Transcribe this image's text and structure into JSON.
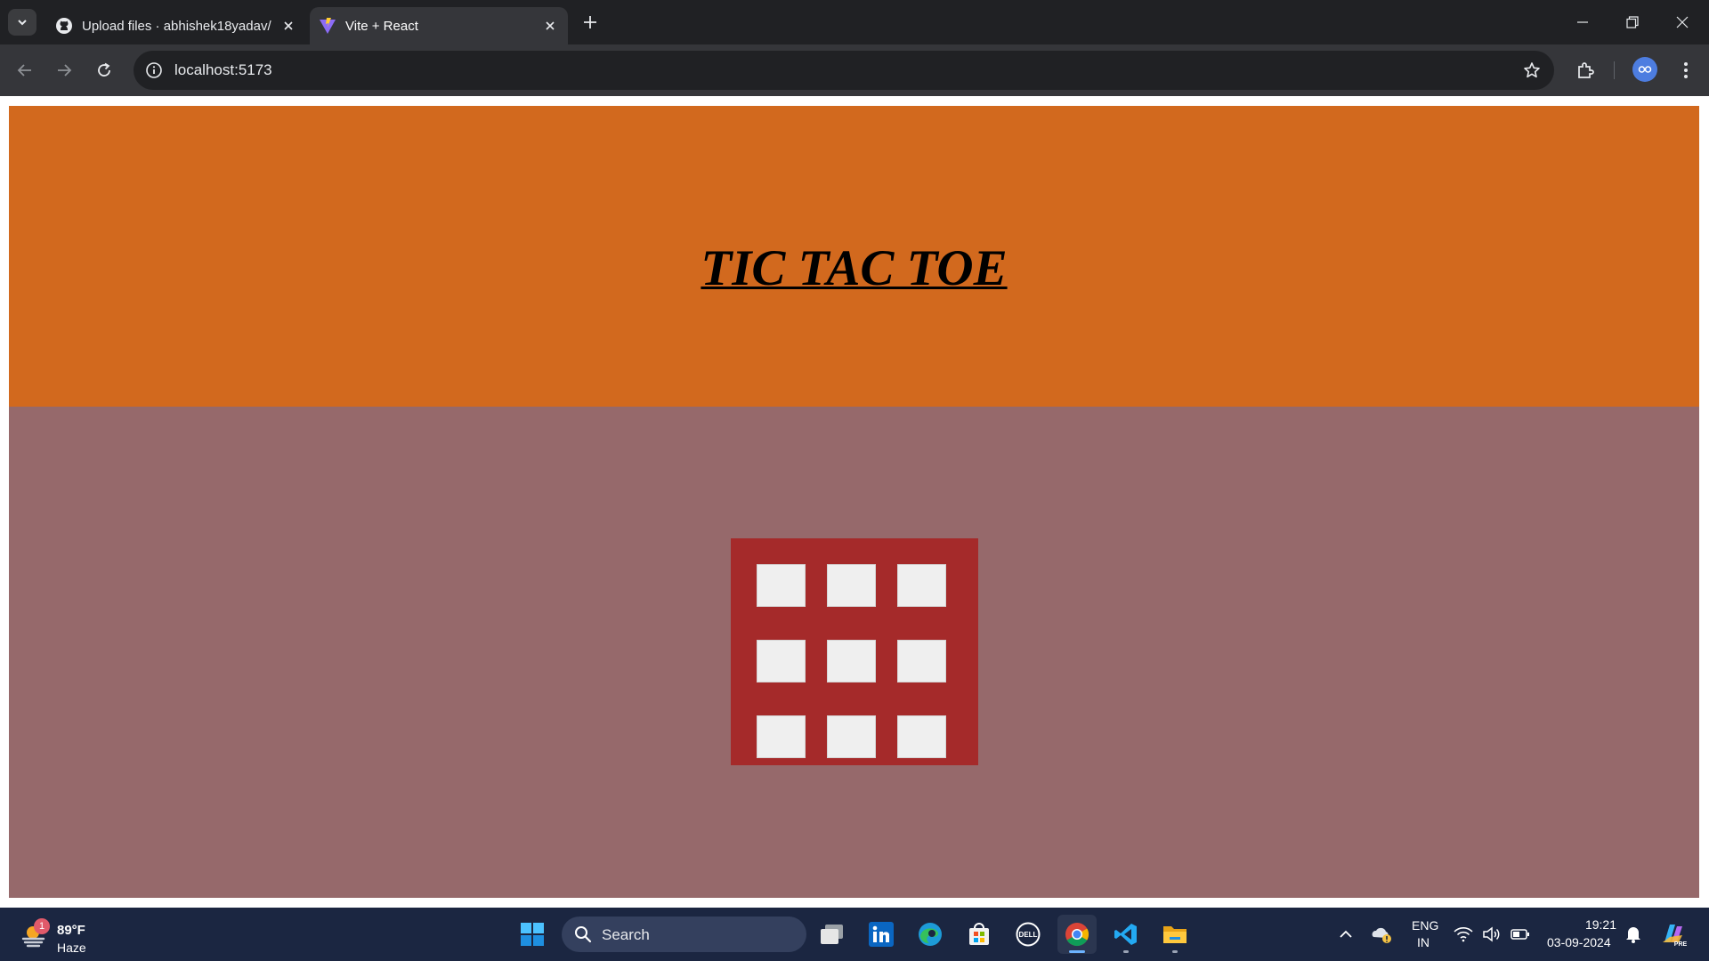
{
  "browser": {
    "tabs": [
      {
        "title": "Upload files · abhishek18yadav/",
        "favicon": "github-icon",
        "active": false
      },
      {
        "title": "Vite + React",
        "favicon": "vite-icon",
        "active": true
      }
    ],
    "url": "localhost:5173"
  },
  "page": {
    "title": "TIC TAC TOE",
    "colors": {
      "header": "#d2691e",
      "play_area": "#96696b",
      "board": "#a52a2a",
      "cell": "#efefef"
    },
    "board": {
      "rows": 3,
      "cols": 3,
      "cells": [
        "",
        "",
        "",
        "",
        "",
        "",
        "",
        "",
        ""
      ]
    }
  },
  "taskbar": {
    "weather": {
      "temp": "89°F",
      "condition": "Haze",
      "badge": "1"
    },
    "search_label": "Search",
    "apps": [
      "windows-start-icon",
      "task-view-icon",
      "linkedin-icon",
      "edge-icon",
      "store-icon",
      "dell-icon",
      "chrome-icon",
      "vscode-icon",
      "file-explorer-icon"
    ],
    "language": {
      "line1": "ENG",
      "line2": "IN"
    },
    "clock": {
      "time": "19:21",
      "date": "03-09-2024"
    }
  }
}
